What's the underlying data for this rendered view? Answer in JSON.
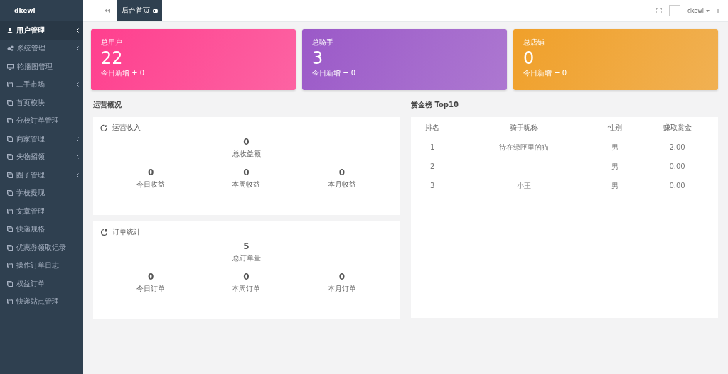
{
  "sidebar": {
    "brand": "dkewl",
    "items": [
      {
        "label": "用户管理",
        "kind": "user",
        "selected": true,
        "expandable": true
      },
      {
        "label": "系统管理",
        "kind": "gears",
        "selected": false,
        "expandable": true
      },
      {
        "label": "轮播图管理",
        "kind": "monitor",
        "selected": false,
        "expandable": false
      },
      {
        "label": "二手市场",
        "kind": "copy",
        "selected": false,
        "expandable": true
      },
      {
        "label": "首页模块",
        "kind": "copy",
        "selected": false,
        "expandable": false
      },
      {
        "label": "分校订单管理",
        "kind": "copy",
        "selected": false,
        "expandable": false
      },
      {
        "label": "商家管理",
        "kind": "copy",
        "selected": false,
        "expandable": true
      },
      {
        "label": "失物招领",
        "kind": "copy",
        "selected": false,
        "expandable": true
      },
      {
        "label": "圈子管理",
        "kind": "copy",
        "selected": false,
        "expandable": true
      },
      {
        "label": "学校提现",
        "kind": "copy",
        "selected": false,
        "expandable": false
      },
      {
        "label": "文章管理",
        "kind": "copy",
        "selected": false,
        "expandable": false
      },
      {
        "label": "快递规格",
        "kind": "copy",
        "selected": false,
        "expandable": false
      },
      {
        "label": "优惠券领取记录",
        "kind": "copy",
        "selected": false,
        "expandable": false
      },
      {
        "label": "操作订单日志",
        "kind": "copy",
        "selected": false,
        "expandable": false
      },
      {
        "label": "权益订单",
        "kind": "copy",
        "selected": false,
        "expandable": false
      },
      {
        "label": "快递站点管理",
        "kind": "copy",
        "selected": false,
        "expandable": false
      }
    ]
  },
  "topbar": {
    "tabs": [
      {
        "label": "后台首页",
        "selected": true
      }
    ],
    "user": "dkewl"
  },
  "stat_cards": [
    {
      "title": "总用户",
      "value": "22",
      "footer": "今日新增 + 0",
      "color": "#ff3f8e"
    },
    {
      "title": "总骑手",
      "value": "3",
      "footer": "今日新增 + 0",
      "color": "#9b59c8"
    },
    {
      "title": "总店铺",
      "value": "0",
      "footer": "今日新增 + 0",
      "color": "#f0a02a"
    }
  ],
  "overview": {
    "title": "运营概况",
    "panels": [
      {
        "title": "运营收入",
        "kind": "income",
        "total": {
          "value": "0",
          "label": "总收益额"
        },
        "stats": [
          {
            "value": "0",
            "label": "今日收益"
          },
          {
            "value": "0",
            "label": "本周收益"
          },
          {
            "value": "0",
            "label": "本月收益"
          }
        ]
      },
      {
        "title": "订单统计",
        "kind": "orders",
        "total": {
          "value": "5",
          "label": "总订单量"
        },
        "stats": [
          {
            "value": "0",
            "label": "今日订单"
          },
          {
            "value": "0",
            "label": "本周订单"
          },
          {
            "value": "0",
            "label": "本月订单"
          }
        ]
      }
    ]
  },
  "ranking": {
    "title": "赏金榜 Top10",
    "columns": [
      "排名",
      "骑手昵称",
      "性别",
      "赚取赏金"
    ],
    "rows": [
      {
        "rank": "1",
        "nickname": "待在绿匣里的猫",
        "gender": "男",
        "bounty": "2.00"
      },
      {
        "rank": "2",
        "gender": "男",
        "bounty": "0.00"
      },
      {
        "rank": "3",
        "nickname": "小王",
        "gender": "男",
        "bounty": "0.00"
      }
    ]
  }
}
